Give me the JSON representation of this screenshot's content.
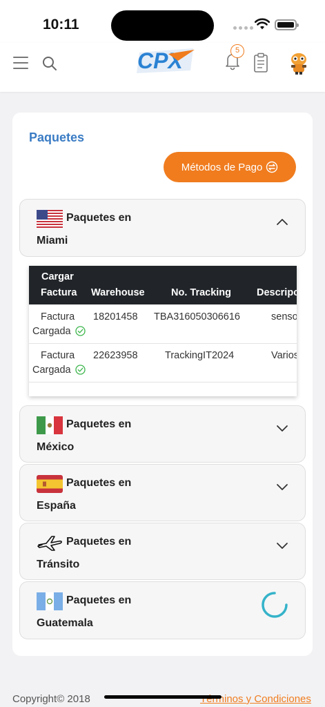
{
  "status_bar": {
    "time": "10:11"
  },
  "header": {
    "logo_text": "CPX",
    "notification_count": "5"
  },
  "page": {
    "title": "Paquetes",
    "pay_button_label": "Métodos de Pago"
  },
  "sections": [
    {
      "label_top": "Paquetes en",
      "label_bottom": "Miami",
      "icon": "us-flag-icon",
      "expanded": true
    },
    {
      "label_top": "Paquetes en",
      "label_bottom": "México",
      "icon": "mexico-flag-icon",
      "expanded": false
    },
    {
      "label_top": "Paquetes en",
      "label_bottom": "España",
      "icon": "spain-flag-icon",
      "expanded": false
    },
    {
      "label_top": "Paquetes en",
      "label_bottom": "Tránsito",
      "icon": "airplane-icon",
      "expanded": false
    },
    {
      "label_top": "Paquetes en",
      "label_bottom": "Guatemala",
      "icon": "guatemala-flag-icon",
      "loading": true
    }
  ],
  "table": {
    "headers": {
      "cargar_line1": "Cargar",
      "cargar_line2": "Factura",
      "warehouse": "Warehouse",
      "tracking": "No. Tracking",
      "description": "Descripción"
    },
    "rows": [
      {
        "status_line1": "Factura",
        "status_line2": "Cargada",
        "warehouse": "18201458",
        "tracking": "TBA316050306616",
        "description": "sensores"
      },
      {
        "status_line1": "Factura",
        "status_line2": "Cargada",
        "warehouse": "22623958",
        "tracking": "TrackingIT2024",
        "description": "Varios"
      }
    ]
  },
  "footer": {
    "copyright": "Copyright© 2018",
    "terms_link": "Términos y Condiciones"
  },
  "colors": {
    "accent": "#f07c1e",
    "title_blue": "#3a7cc4",
    "table_header": "#212529",
    "check_green": "#3bb54a",
    "spinner": "#35b3c9"
  }
}
